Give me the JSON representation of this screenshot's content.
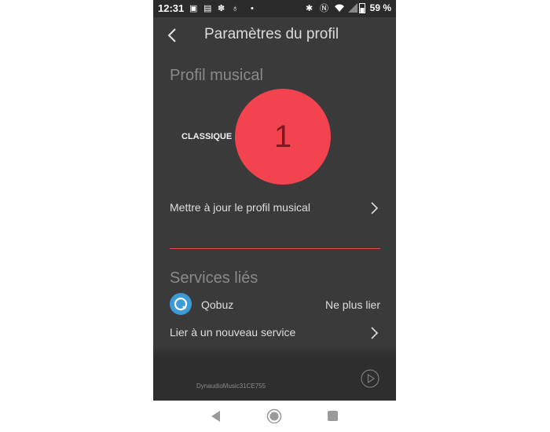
{
  "status_bar": {
    "time": "12:31",
    "battery": "59 %"
  },
  "header": {
    "title": "Paramètres du profil"
  },
  "music_profile": {
    "section_title": "Profil musical",
    "genre_label": "CLASSIQUE",
    "profile_number": "1",
    "circle_color": "#f2434f",
    "update_label": "Mettre à jour le profil musical"
  },
  "linked_services": {
    "section_title": "Services liés",
    "services": [
      {
        "name": "Qobuz",
        "action": "Ne plus lier",
        "icon": "qobuz-icon"
      }
    ],
    "add_label": "Lier à un nouveau service"
  },
  "player": {
    "device_name": "DynaudioMusic31CE755"
  },
  "colors": {
    "background": "#3a3a3a",
    "accent": "#e04a4a"
  }
}
